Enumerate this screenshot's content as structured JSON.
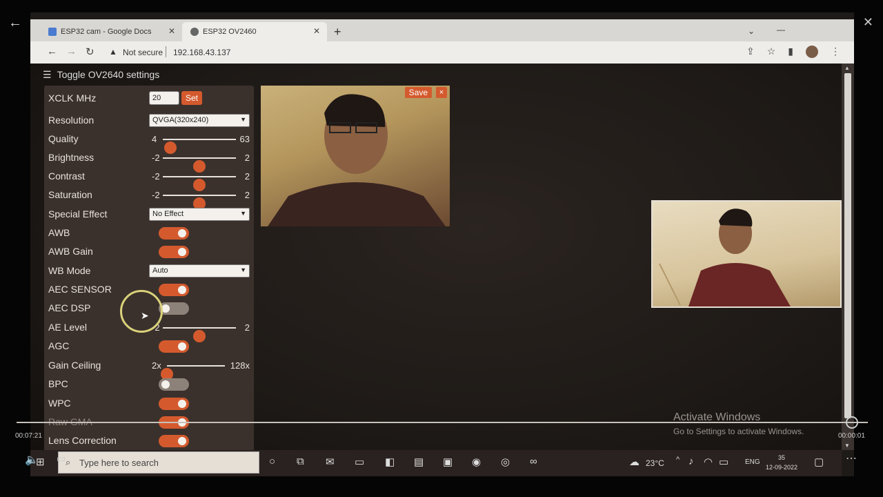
{
  "browser": {
    "tabs": [
      {
        "label": "ESP32 cam - Google Docs"
      },
      {
        "label": "ESP32 OV2460"
      }
    ],
    "address": {
      "security": "Not secure",
      "url": "192.168.43.137"
    }
  },
  "page": {
    "toggle_title": "Toggle OV2640 settings",
    "settings": {
      "xclk": {
        "label": "XCLK MHz",
        "value": "20",
        "button": "Set"
      },
      "resolution": {
        "label": "Resolution",
        "value": "QVGA(320x240)"
      },
      "quality": {
        "label": "Quality",
        "min": "4",
        "max": "63",
        "value": 10
      },
      "brightness": {
        "label": "Brightness",
        "min": "-2",
        "max": "2",
        "value": 0
      },
      "contrast": {
        "label": "Contrast",
        "min": "-2",
        "max": "2",
        "value": 0
      },
      "saturation": {
        "label": "Saturation",
        "min": "-2",
        "max": "2",
        "value": 0
      },
      "special_effect": {
        "label": "Special Effect",
        "value": "No Effect"
      },
      "awb": {
        "label": "AWB",
        "on": true
      },
      "awb_gain": {
        "label": "AWB Gain",
        "on": true
      },
      "wb_mode": {
        "label": "WB Mode",
        "value": "Auto"
      },
      "aec_sensor": {
        "label": "AEC SENSOR",
        "on": true
      },
      "aec_dsp": {
        "label": "AEC DSP",
        "on": false
      },
      "ae_level": {
        "label": "AE Level",
        "min": "-2",
        "max": "2",
        "value": 0
      },
      "agc": {
        "label": "AGC",
        "on": true
      },
      "gain_ceiling": {
        "label": "Gain Ceiling",
        "min": "2x",
        "max": "128x",
        "value": 0
      },
      "bpc": {
        "label": "BPC",
        "on": false
      },
      "wpc": {
        "label": "WPC",
        "on": true
      },
      "raw_gma": {
        "label": "Raw GMA",
        "on": true
      },
      "lens_correction": {
        "label": "Lens Correction",
        "on": true
      }
    },
    "stream": {
      "save": "Save",
      "close": "×"
    },
    "watermark": {
      "line1": "Activate Windows",
      "line2": "Go to Settings to activate Windows."
    }
  },
  "player": {
    "time_elapsed": "00:07:21",
    "time_remaining": "00:00:01"
  },
  "taskbar": {
    "search_placeholder": "Type here to search",
    "temperature": "23°C",
    "language": "ENG",
    "time": "35",
    "date": "12-09-2022"
  },
  "colors": {
    "accent": "#d45a2e",
    "panel": "#3b312c"
  }
}
